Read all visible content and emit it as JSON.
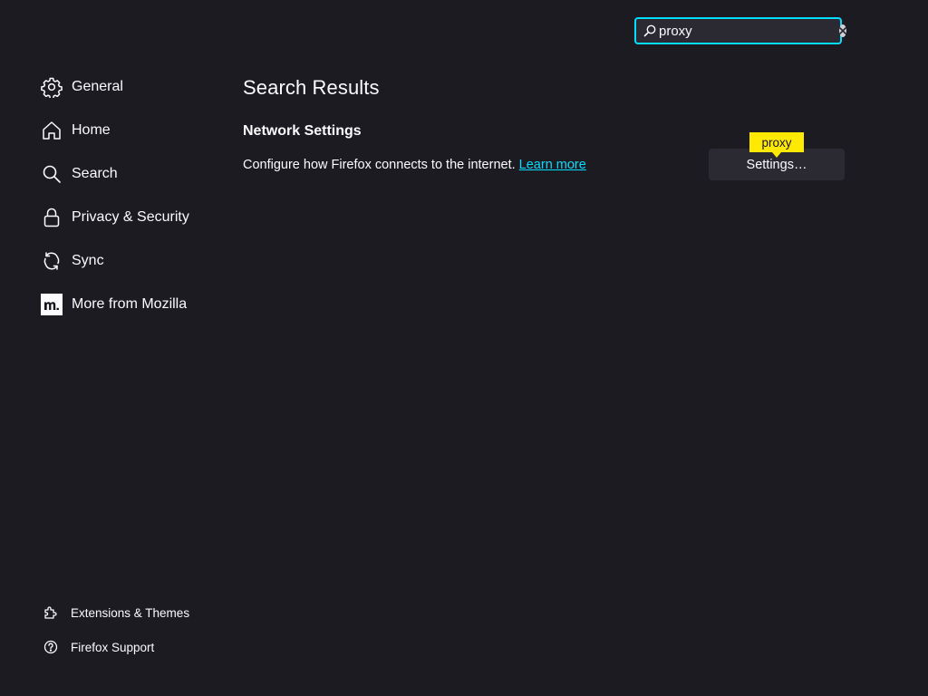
{
  "search": {
    "value": "proxy",
    "placeholder": ""
  },
  "sidebar": {
    "items": [
      {
        "label": "General",
        "icon": "gear-icon"
      },
      {
        "label": "Home",
        "icon": "home-icon"
      },
      {
        "label": "Search",
        "icon": "search-icon"
      },
      {
        "label": "Privacy & Security",
        "icon": "lock-icon"
      },
      {
        "label": "Sync",
        "icon": "sync-icon"
      },
      {
        "label": "More from Mozilla",
        "icon": "mozilla-m-icon"
      }
    ],
    "footer": [
      {
        "label": "Extensions & Themes",
        "icon": "puzzle-piece-icon"
      },
      {
        "label": "Firefox Support",
        "icon": "help-circle-icon"
      }
    ]
  },
  "main": {
    "title": "Search Results",
    "section": {
      "title": "Network Settings",
      "description": "Configure how Firefox connects to the internet.",
      "link_label": "Learn more",
      "button_label": "Settings…",
      "highlight_label": "proxy"
    }
  },
  "colors": {
    "background": "#1c1b22",
    "accent": "#00ddff",
    "highlight": "#ffe900",
    "button_bg": "#2b2a33"
  }
}
